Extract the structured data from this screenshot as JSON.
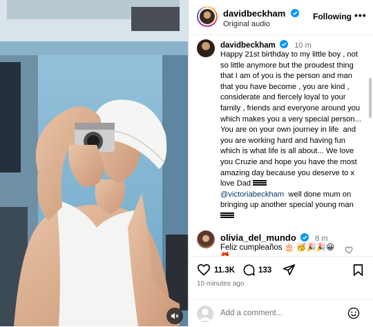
{
  "post": {
    "author": "davidbeckham",
    "verified": true,
    "audio_label": "Original audio",
    "follow_label": "Following",
    "more_label": "•••"
  },
  "caption": {
    "username": "davidbeckham",
    "time": "10 m",
    "text_main": "Happy 21st birthday to my little boy , not so little anymore but the proudest thing that I am of you is the person and man that you have become , you are kind , considerate and fiercely loyal to your family , friends and everyone around you which makes you a very special person... You are on your own journey in life  and you are working hard and having fun which is what life is all about... We love you Cruzie and hope you have the most amazing day because you deserve to x love Dad ",
    "mention": "@victoriabeckham",
    "text_after": "  well done mum on bringing up another special young man "
  },
  "comment": {
    "username": "olivia_del_mundo",
    "time": "8 m",
    "text": "Feliz cumpleaños 🎂 🥳🎉🎉😀",
    "extra": "🎁"
  },
  "actions": {
    "likes": "11.3K",
    "comments": "133"
  },
  "posted_time": "10 minutes ago",
  "add_comment": {
    "placeholder": "Add a comment..."
  },
  "icons": [
    "heart-icon",
    "comment-icon",
    "share-icon",
    "bookmark-icon",
    "emoji-icon",
    "muted-speaker-icon",
    "verified-icon",
    "more-icon"
  ],
  "colors": {
    "verified_blue": "#0095f6",
    "mention_blue": "#00376b",
    "secondary_text": "#737373"
  }
}
